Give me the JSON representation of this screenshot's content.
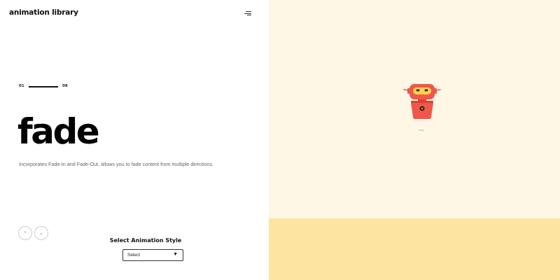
{
  "header": {
    "logo": "animation library",
    "menu_icon": "hamburger-menu-icon"
  },
  "slide": {
    "current": "01",
    "total": "08",
    "title": "fade",
    "description": "Incorporates Fade-In and Fade-Out, allows you to fade content from multiple directions."
  },
  "navigation": {
    "up_icon": "chevron-up-icon",
    "down_icon": "chevron-down-icon",
    "up_glyph": "⌃",
    "down_glyph": "⌄"
  },
  "stage": {
    "character_icon": "robot-icon"
  },
  "controls": {
    "label": "Select Animation Style",
    "select_value": "Select",
    "arrow_glyph": "▼"
  },
  "colors": {
    "stage_bg": "#fef7e5",
    "controls_bg": "#fee4a1",
    "robot_red": "#f0574a",
    "robot_visor": "#ffd24c"
  }
}
